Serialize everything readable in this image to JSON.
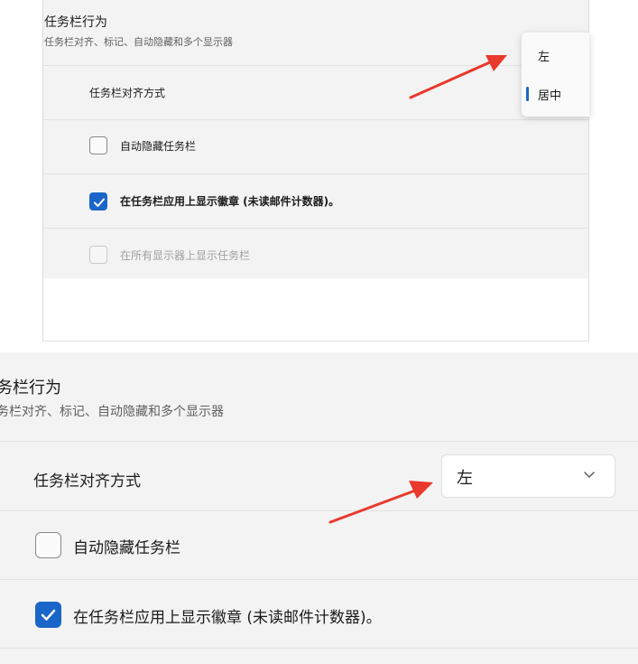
{
  "top_screenshot": {
    "section_title": "任务栏行为",
    "section_subtitle": "任务栏对齐、标记、自动隐藏和多个显示器",
    "alignment_label": "任务栏对齐方式",
    "dropdown_options": [
      "左",
      "居中"
    ],
    "dropdown_selected": "居中",
    "autohide_label": "自动隐藏任务栏",
    "autohide_checked": false,
    "badges_label": "在任务栏应用上显示徽章 (未读邮件计数器)。",
    "badges_checked": true,
    "all_displays_label": "在所有显示器上显示任务栏",
    "all_displays_enabled": false
  },
  "bottom_screenshot": {
    "section_title": "务栏行为",
    "section_subtitle": "务栏对齐、标记、自动隐藏和多个显示器",
    "alignment_label": "任务栏对齐方式",
    "alignment_value": "左",
    "autohide_label": "自动隐藏任务栏",
    "autohide_checked": false,
    "badges_label": "在任务栏应用上显示徽章 (未读邮件计数器)。",
    "badges_checked": true
  },
  "colors": {
    "accent": "#1a66c8",
    "arrow": "#e8392c",
    "panel_bg": "#f3f3f3"
  }
}
